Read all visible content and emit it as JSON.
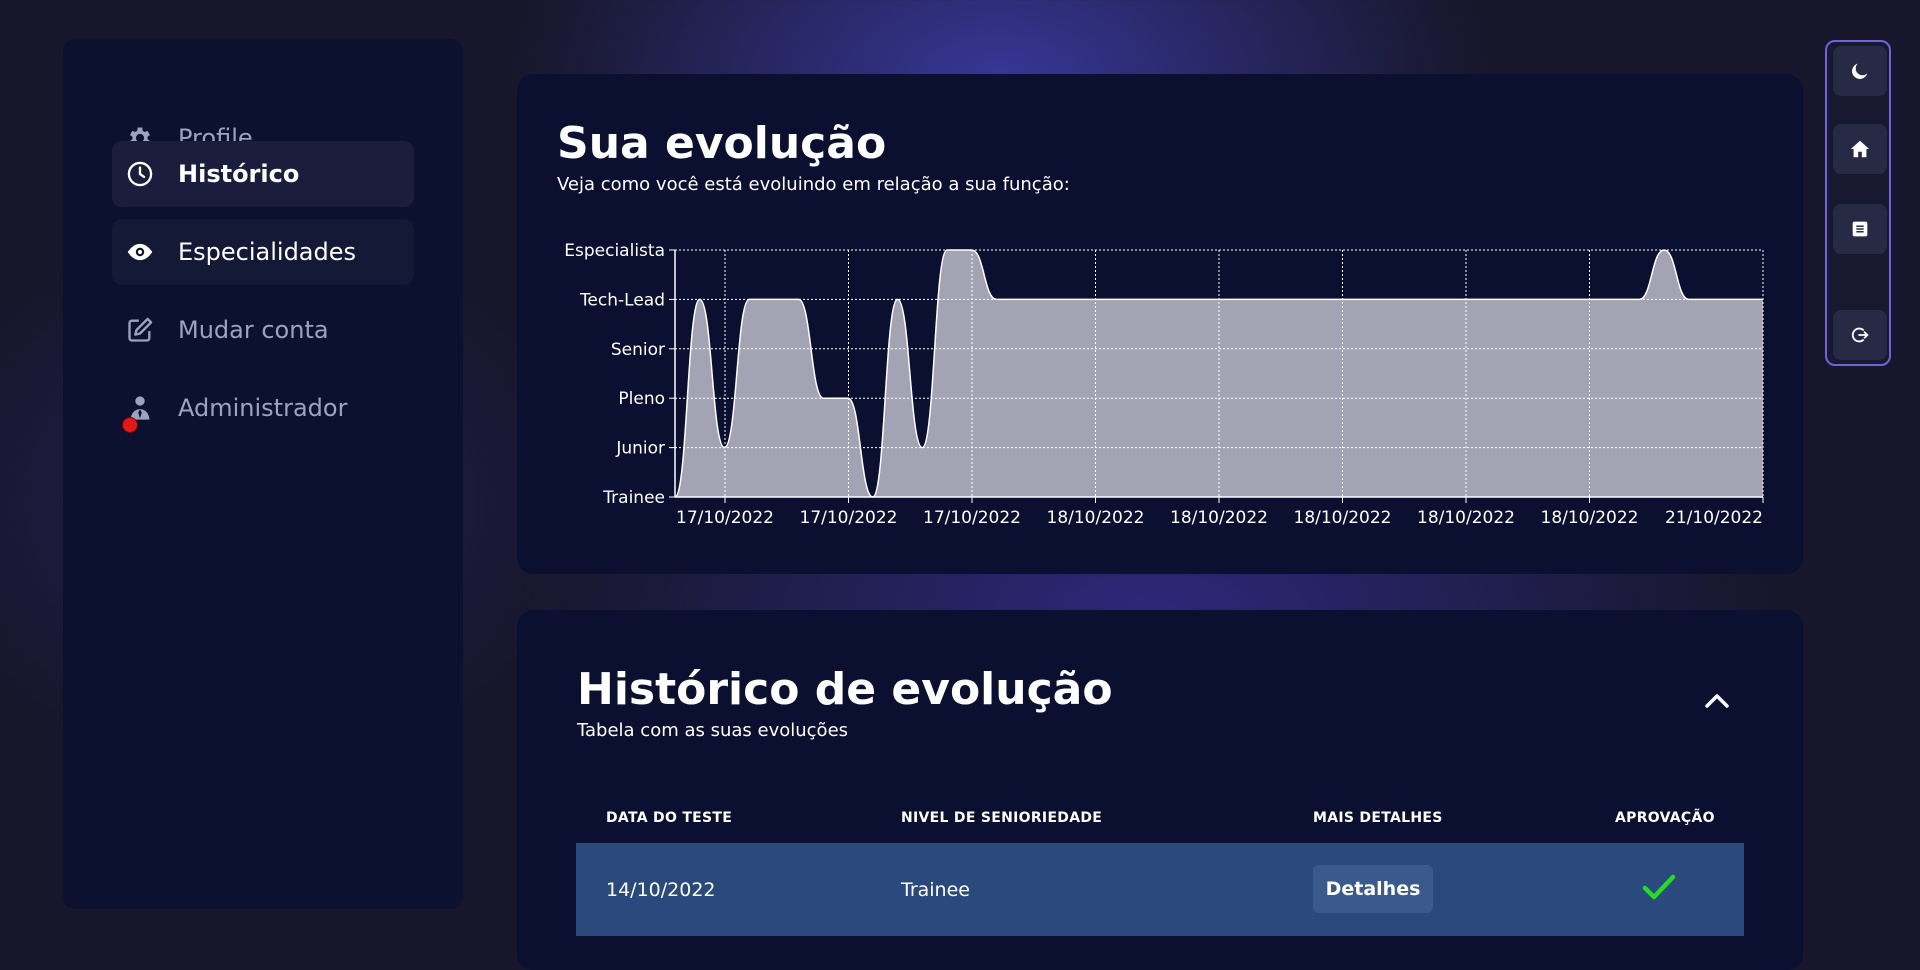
{
  "sidebar": {
    "items": [
      {
        "label": "Profile",
        "icon": "gear-icon"
      },
      {
        "label": "Histórico",
        "icon": "clock-icon",
        "active": true
      },
      {
        "label": "Especialidades",
        "icon": "eye-icon"
      },
      {
        "label": "Mudar conta",
        "icon": "edit-icon"
      },
      {
        "label": "Administrador",
        "icon": "admin-icon",
        "badge_color": "#e01818"
      }
    ]
  },
  "evolution": {
    "title": "Sua evolução",
    "subtitle": "Veja como você está evoluindo em relação a sua função:"
  },
  "chart_data": {
    "type": "area",
    "title": "",
    "xlabel": "",
    "ylabel": "",
    "y_categories": [
      "Trainee",
      "Junior",
      "Pleno",
      "Senior",
      "Tech-Lead",
      "Especialista"
    ],
    "x_ticks": [
      "17/10/2022",
      "17/10/2022",
      "17/10/2022",
      "18/10/2022",
      "18/10/2022",
      "18/10/2022",
      "18/10/2022",
      "18/10/2022",
      "21/10/2022"
    ],
    "values": [
      0,
      4,
      1,
      4,
      4,
      4,
      2,
      2,
      0,
      4,
      1,
      5,
      5,
      4,
      4,
      4,
      4,
      4,
      4,
      4,
      4,
      4,
      4,
      4,
      4,
      4,
      4,
      4,
      4,
      4,
      4,
      4,
      4,
      4,
      4,
      4,
      4,
      4,
      4,
      4,
      5,
      4,
      4,
      4,
      4
    ],
    "grid": true,
    "fill_color": "#a3a3b4",
    "line_color": "#ffffff"
  },
  "history": {
    "title": "Histórico de evolução",
    "subtitle": "Tabela com as suas evoluções",
    "columns": [
      "DATA DO TESTE",
      "NIVEL DE SENIORIEDADE",
      "MAIS DETALHES",
      "APROVAÇÃO"
    ],
    "rows": [
      {
        "date": "14/10/2022",
        "level": "Trainee",
        "details_label": "Detalhes",
        "approved": true
      }
    ],
    "approved_color": "#22dd22",
    "row_color": "#2a4a7e"
  },
  "rightbar": {
    "buttons": [
      "moon-icon",
      "home-icon",
      "list-icon",
      "logout-icon"
    ]
  }
}
